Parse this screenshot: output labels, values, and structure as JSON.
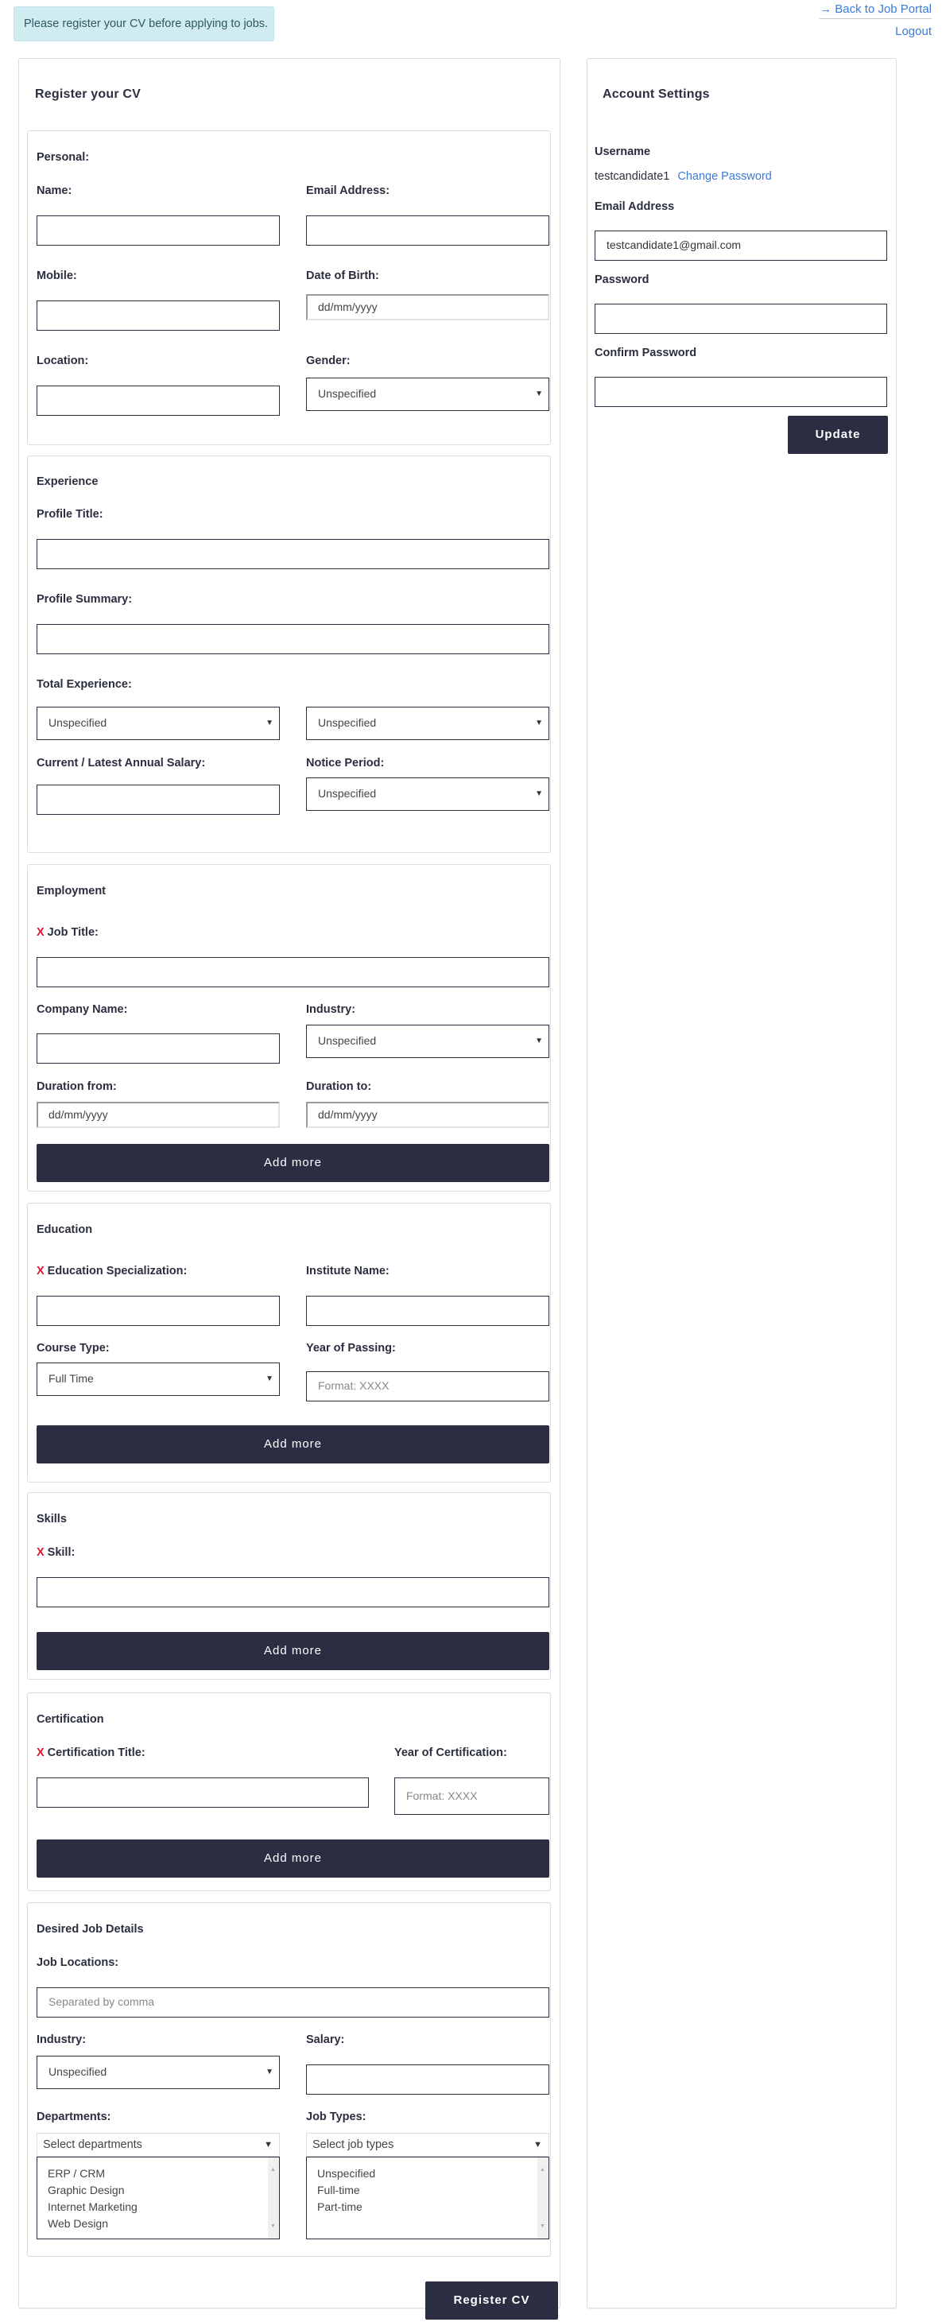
{
  "alert": {
    "message": "Please register your CV before applying to jobs."
  },
  "top_links": {
    "back": "→ Back to Job Portal",
    "logout": "Logout"
  },
  "register": {
    "title": "Register your CV",
    "personal": {
      "title": "Personal:",
      "name_label": "Name:",
      "email_label": "Email Address:",
      "mobile_label": "Mobile:",
      "dob_label": "Date of Birth:",
      "dob_placeholder": "dd/mm/yyyy",
      "location_label": "Location:",
      "gender_label": "Gender:",
      "gender_value": "Unspecified"
    },
    "experience": {
      "title": "Experience",
      "profile_title_label": "Profile Title:",
      "profile_summary_label": "Profile Summary:",
      "total_experience_label": "Total Experience:",
      "years_value": "Unspecified",
      "months_value": "Unspecified",
      "salary_label": "Current / Latest Annual Salary:",
      "notice_label": "Notice Period:",
      "notice_value": "Unspecified"
    },
    "employment": {
      "title": "Employment",
      "required_mark": "X",
      "job_title_label": "Job Title:",
      "company_label": "Company Name:",
      "industry_label": "Industry:",
      "industry_value": "Unspecified",
      "from_label": "Duration from:",
      "from_placeholder": "dd/mm/yyyy",
      "to_label": "Duration to:",
      "to_placeholder": "dd/mm/yyyy",
      "add_more": "Add more"
    },
    "education": {
      "title": "Education",
      "required_mark": "X",
      "specialization_label": "Education Specialization:",
      "institute_label": "Institute Name:",
      "course_label": "Course Type:",
      "course_value": "Full Time",
      "year_label": "Year of Passing:",
      "year_placeholder": "Format: XXXX",
      "add_more": "Add more"
    },
    "skills": {
      "title": "Skills",
      "required_mark": "X",
      "skill_label": "Skill:",
      "add_more": "Add more"
    },
    "certification": {
      "title": "Certification",
      "required_mark": "X",
      "cert_title_label": "Certification Title:",
      "year_label": "Year of Certification:",
      "year_placeholder": "Format: XXXX",
      "add_more": "Add more"
    },
    "desired": {
      "title": "Desired Job Details",
      "locations_label": "Job Locations:",
      "locations_placeholder": "Separated by comma",
      "industry_label": "Industry:",
      "industry_value": "Unspecified",
      "salary_label": "Salary:",
      "departments_label": "Departments:",
      "departments_placeholder": "Select departments",
      "departments_options": [
        "ERP / CRM",
        "Graphic Design",
        "Internet Marketing",
        "Web Design"
      ],
      "job_types_label": "Job Types:",
      "job_types_placeholder": "Select job types",
      "job_types_options": [
        "Unspecified",
        "Full-time",
        "Part-time"
      ]
    },
    "submit": "Register CV"
  },
  "account": {
    "title": "Account Settings",
    "username_label": "Username",
    "username_value": "testcandidate1",
    "change_password": "Change Password",
    "email_label": "Email Address",
    "email_value": "testcandidate1@gmail.com",
    "password_label": "Password",
    "confirm_label": "Confirm Password",
    "update": "Update"
  }
}
